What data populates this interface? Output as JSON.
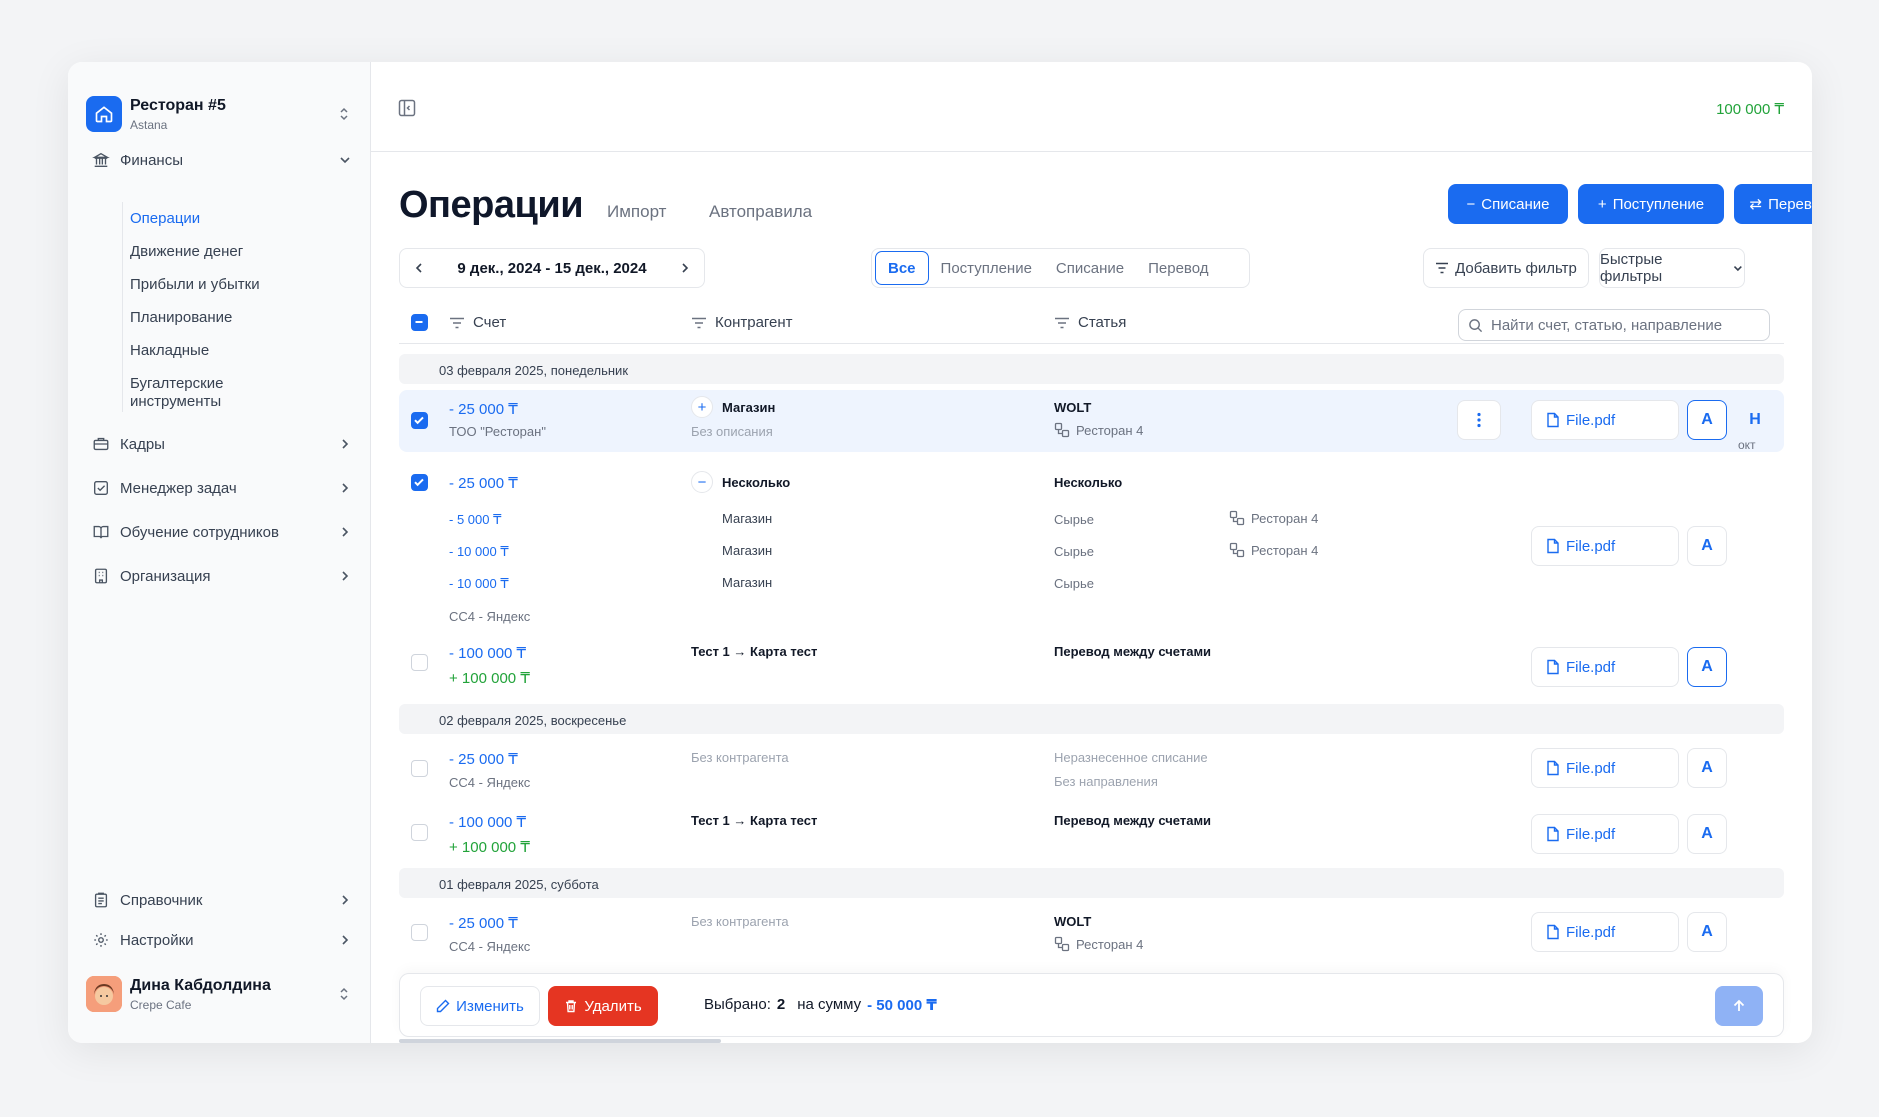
{
  "org": {
    "name": "Ресторан #5",
    "city": "Astana"
  },
  "nav": {
    "finance": "Финансы",
    "finance_items": [
      "Операции",
      "Движение денег",
      "Прибыли и убытки",
      "Планирование",
      "Накладные",
      "Бугалтерские",
      "инструменты"
    ],
    "groups": [
      "Кадры",
      "Менеджер задач",
      "Обучение сотрудников",
      "Организация"
    ],
    "bottom": [
      "Справочник",
      "Настройки"
    ]
  },
  "user": {
    "name": "Дина Кабдолдина",
    "place": "Crepe Cafe"
  },
  "header": {
    "balance": "100 000 ₸"
  },
  "page": {
    "title": "Операции",
    "tabs": [
      "Импорт",
      "Автоправила"
    ],
    "actions": {
      "writeoff": "Списание",
      "income": "Поступление",
      "transfer": "Перевод"
    },
    "date_range": "9 дек., 2024 - 15 дек., 2024",
    "segments": [
      "Все",
      "Поступление",
      "Списание",
      "Перевод"
    ],
    "add_filter": "Добавить фильтр",
    "quick_filters": "Быстрые фильтры"
  },
  "table": {
    "columns": {
      "account": "Счет",
      "counterparty": "Контрагент",
      "category": "Статья"
    },
    "search_placeholder": "Найти счет, статью, направление",
    "groups": [
      "03 февраля 2025, понедельник",
      "02 февраля 2025, воскресенье",
      "01 февраля 2025, суббота"
    ],
    "r1": {
      "amount": "- 25 000 ₸",
      "account": "ТОО \"Ресторан\"",
      "counterparty": "Магазин",
      "desc": "Без описания",
      "category": "WOLT",
      "branch": "Ресторан 4",
      "file": "File.pdf",
      "a": "A",
      "h": "Н",
      "h_sub": "окт"
    },
    "r2": {
      "amount": "- 25 000 ₸",
      "counterparty": "Несколько",
      "category": "Несколько",
      "file": "File.pdf",
      "a": "A",
      "splits": [
        {
          "amount": "- 5 000 ₸",
          "counterparty": "Магазин",
          "category": "Сырье",
          "branch": "Ресторан 4"
        },
        {
          "amount": "- 10 000 ₸",
          "counterparty": "Магазин",
          "category": "Сырье",
          "branch": "Ресторан 4"
        },
        {
          "amount": "- 10 000 ₸",
          "counterparty": "Магазин",
          "category": "Сырье",
          "branch": ""
        }
      ],
      "account": "CC4 - Яндекс"
    },
    "r3": {
      "amount": "- 100 000 ₸",
      "amount2": "+ 100 000 ₸",
      "counterparty": "Тест 1 → Карта тест",
      "category": "Перевод между счетами",
      "file": "File.pdf",
      "a": "A"
    },
    "r4": {
      "amount": "- 25 000 ₸",
      "account": "CC4 - Яндекс",
      "counterparty": "Без контрагента",
      "category": "Неразнесенное списание",
      "direction": "Без направления",
      "file": "File.pdf",
      "a": "A"
    },
    "r5": {
      "amount": "- 100 000 ₸",
      "amount2": "+ 100 000 ₸",
      "counterparty": "Тест 1 → Карта тест",
      "category": "Перевод между счетами",
      "file": "File.pdf",
      "a": "A"
    },
    "r6": {
      "amount": "- 25 000 ₸",
      "account": "CC4 - Яндекс",
      "counterparty": "Без контрагента",
      "category": "WOLT",
      "branch": "Ресторан 4",
      "file": "File.pdf",
      "a": "A"
    }
  },
  "footer": {
    "edit": "Изменить",
    "delete": "Удалить",
    "selected_label": "Выбрано:",
    "selected_count": "2",
    "sum_label": "на сумму",
    "sum": "- 50 000 ₸"
  }
}
